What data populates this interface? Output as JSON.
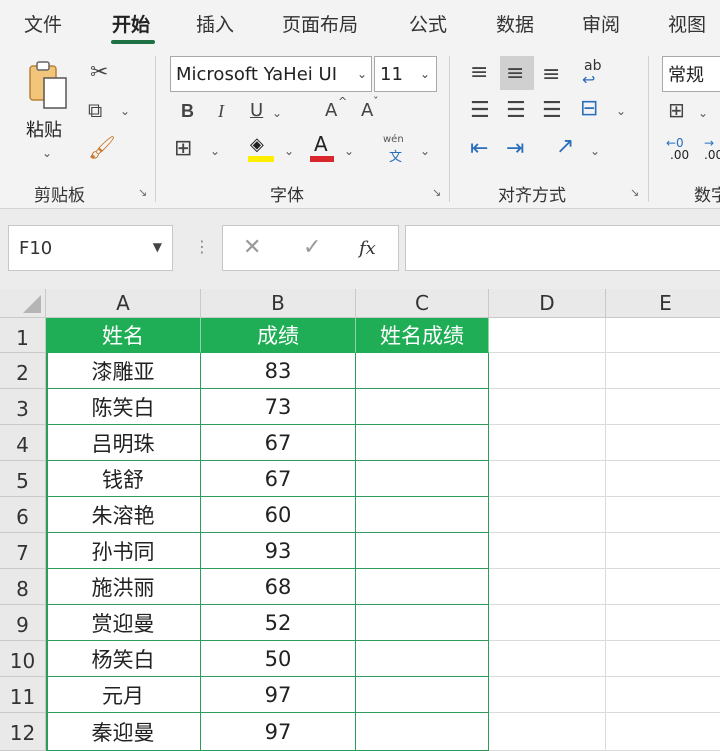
{
  "tabs": [
    "文件",
    "开始",
    "插入",
    "页面布局",
    "公式",
    "数据",
    "审阅",
    "视图"
  ],
  "ribbon": {
    "clipboard": {
      "label": "剪贴板",
      "paste_label": "粘贴"
    },
    "font": {
      "label": "字体",
      "font_name": "Microsoft YaHei UI",
      "font_size": "11",
      "bold": "B",
      "italic": "I",
      "underline": "U",
      "grow": "A",
      "shrink": "A",
      "font_color_letter": "A",
      "phonetic": "wén",
      "phonetic_char": "文"
    },
    "alignment": {
      "label": "对齐方式",
      "wrap_text": "ab"
    },
    "number": {
      "label": "数字",
      "format": "常规",
      "inc_decimal": ".00",
      "dec_decimal": ".00"
    },
    "colors": {
      "highlight": "#ffee00",
      "font_color": "#d9262c",
      "accent": "#1e7145",
      "header_fill": "#1fae56",
      "grid_border": "#2e9a5c"
    }
  },
  "formula_bar": {
    "cell_ref": "F10",
    "cancel": "✕",
    "enter": "✓",
    "fx": "fx",
    "value": ""
  },
  "columns": [
    "A",
    "B",
    "C",
    "D",
    "E"
  ],
  "rows": [
    "1",
    "2",
    "3",
    "4",
    "5",
    "6",
    "7",
    "8",
    "9",
    "10",
    "11",
    "12"
  ],
  "table": {
    "headers": [
      "姓名",
      "成绩",
      "姓名成绩"
    ],
    "data": [
      [
        "漆雕亚",
        "83"
      ],
      [
        "陈笑白",
        "73"
      ],
      [
        "吕明珠",
        "67"
      ],
      [
        "钱舒",
        "67"
      ],
      [
        "朱溶艳",
        "60"
      ],
      [
        "孙书同",
        "93"
      ],
      [
        "施洪丽",
        "68"
      ],
      [
        "赏迎曼",
        "52"
      ],
      [
        "杨笑白",
        "50"
      ],
      [
        "元月",
        "97"
      ],
      [
        "秦迎曼",
        "97"
      ]
    ]
  }
}
